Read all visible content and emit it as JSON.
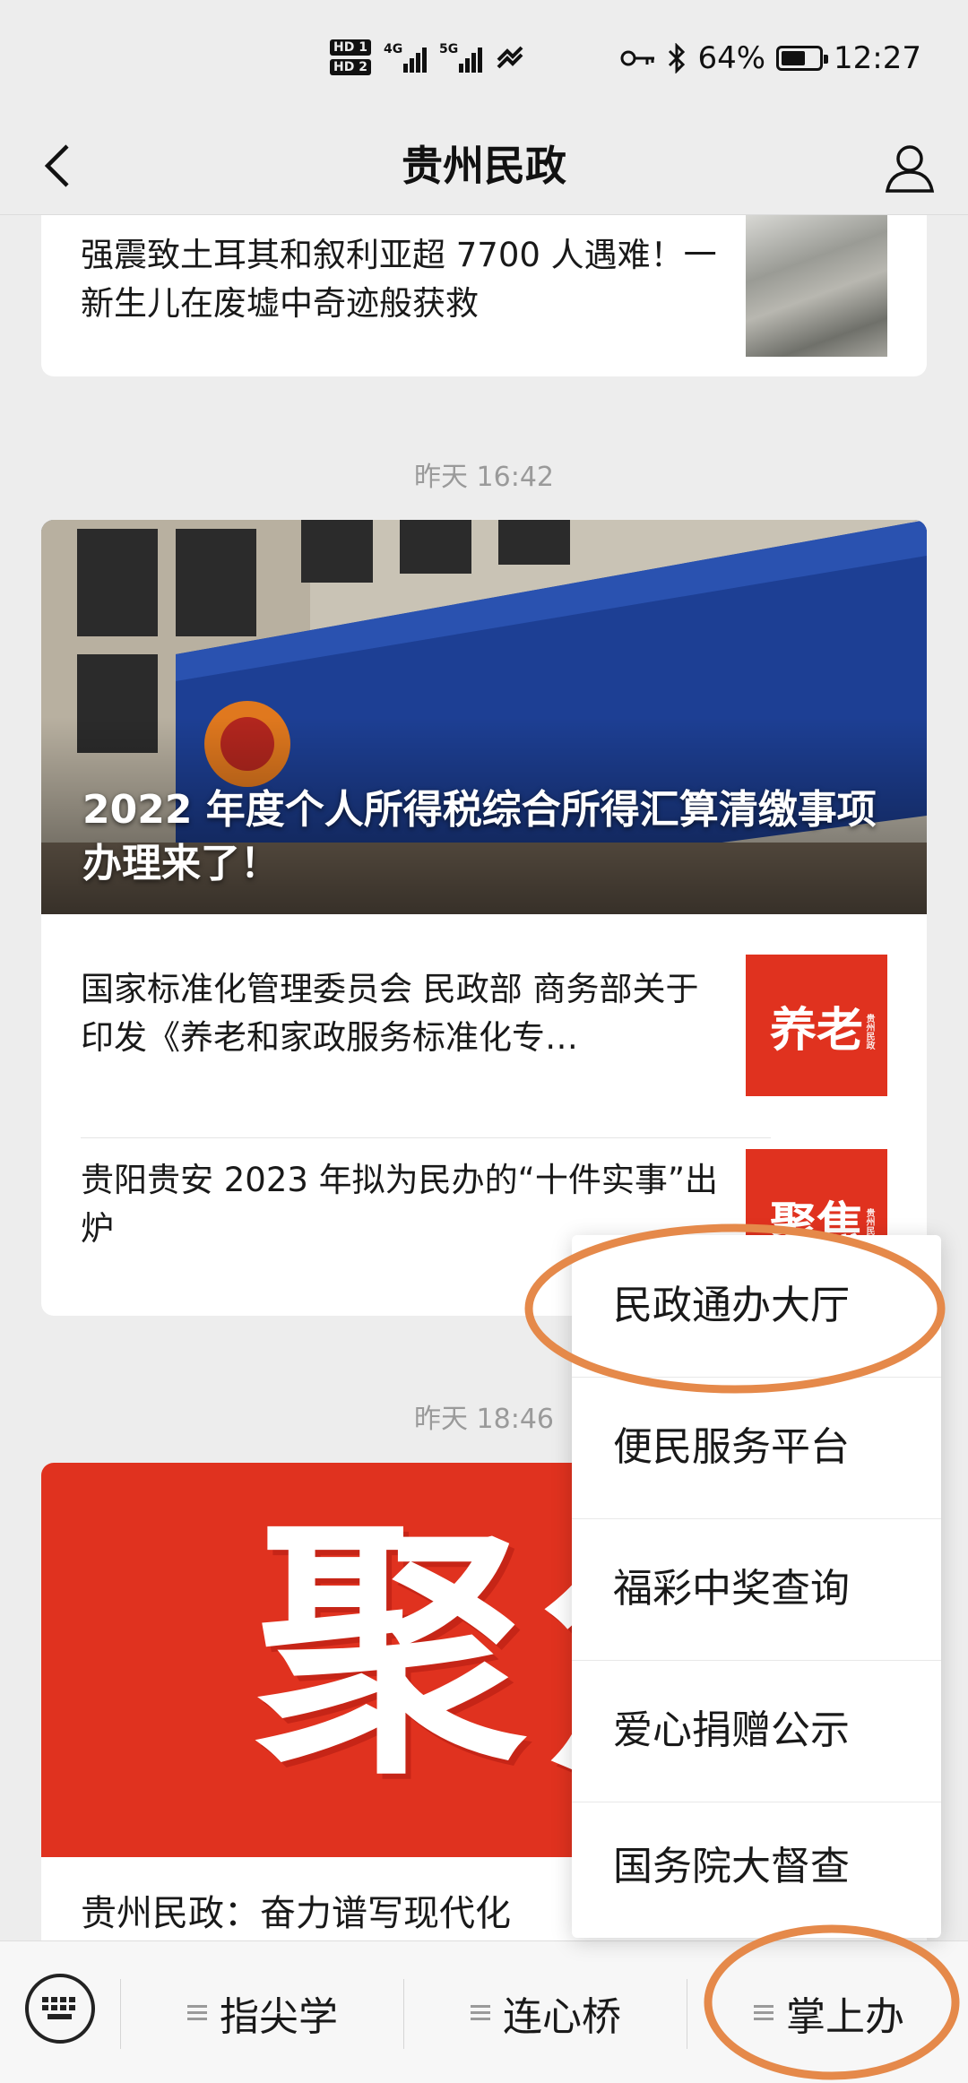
{
  "status_bar": {
    "hd1": "HD 1",
    "hd2": "HD 2",
    "net1": "4G",
    "net2": "5G",
    "battery_pct": "64%",
    "battery_level": 0.64,
    "time": "12:27"
  },
  "header": {
    "title": "贵州民政",
    "back_icon": "chevron-left-icon",
    "profile_icon": "user-icon"
  },
  "feed": {
    "card1": {
      "item_title": "强震致土耳其和叙利亚超 7700 人遇难！一新生儿在废墟中奇迹般获救"
    },
    "time2": "昨天 16:42",
    "card2": {
      "hero_title": "2022 年度个人所得税综合所得汇算清缴事项办理来了！",
      "items": [
        {
          "title": "国家标准化管理委员会 民政部 商务部关于印发《养老和家政服务标准化专…",
          "thumb_text": "养老",
          "thumb_small": "贵州民政"
        },
        {
          "title": "贵阳贵安 2023 年拟为民办的“十件实事”出炉",
          "thumb_text": "聚焦",
          "thumb_small": "贵州民政"
        }
      ]
    },
    "time3": "昨天 18:46",
    "card3": {
      "banner_text": "聚焦",
      "title": "贵州民政：奋力谱写现代化"
    }
  },
  "popup_menu": {
    "items": [
      "民政通办大厅",
      "便民服务平台",
      "福彩中奖查询",
      "爱心捐赠公示",
      "国务院大督查"
    ]
  },
  "bottom_menu": {
    "keyboard_icon": "keyboard-icon",
    "items": [
      "指尖学",
      "连心桥",
      "掌上办"
    ]
  },
  "colors": {
    "accent_red": "#e0321f",
    "annotation_orange": "#e5894a",
    "background": "#ededed"
  }
}
